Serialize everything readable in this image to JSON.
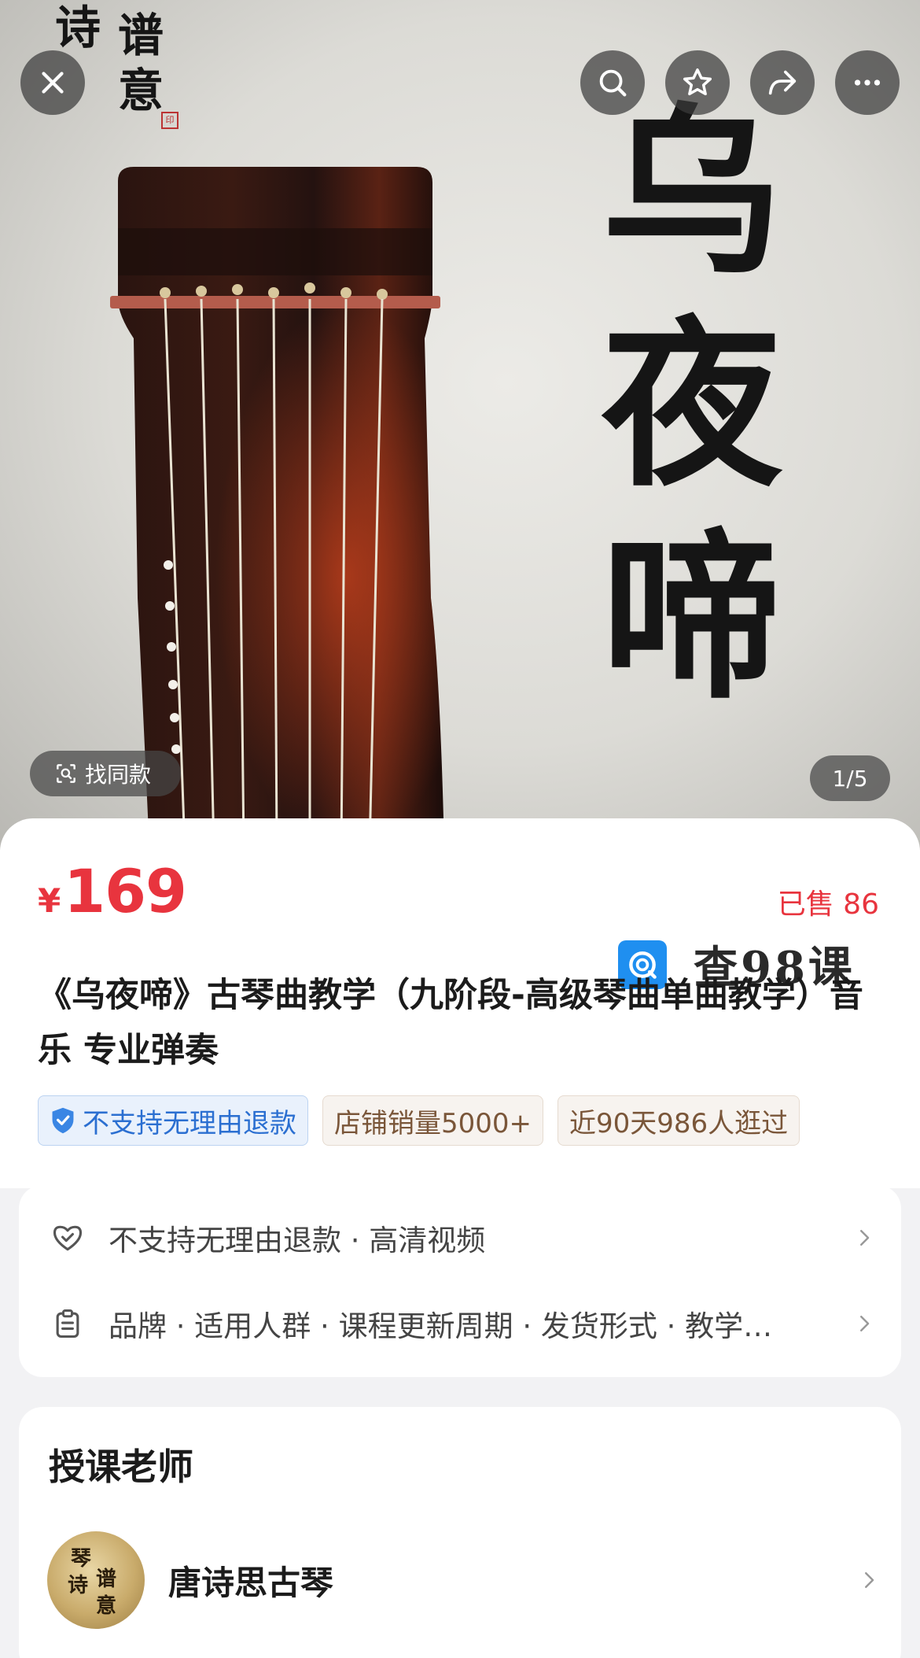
{
  "hero": {
    "calligraphy": [
      "乌",
      "夜",
      "啼"
    ],
    "logo_chars": [
      "诗",
      "谱",
      "意"
    ],
    "seal": "印",
    "image_counter": "1/5",
    "find_same_label": "找同款",
    "icons": {
      "close": "close-icon",
      "search": "search-icon",
      "favorite": "star-icon",
      "share": "share-icon",
      "more": "more-icon"
    }
  },
  "product": {
    "currency": "¥",
    "price": "169",
    "sold": "已售 86",
    "title": "《乌夜啼》古琴曲教学（九阶段-高级琴曲单曲教学）音乐 专业弹奏",
    "watermark": "查98课",
    "tags": [
      {
        "label": "不支持无理由退款",
        "style": "blue",
        "icon": "shield-check-icon"
      },
      {
        "label": "店铺销量5000+",
        "style": "tan"
      },
      {
        "label": "近90天986人逛过",
        "style": "tan"
      }
    ]
  },
  "services": {
    "row1": "不支持无理由退款 · 高清视频",
    "row2": "品牌 · 适用人群 · 课程更新周期 · 发货形式 · 教学…"
  },
  "teacher": {
    "heading": "授课老师",
    "name": "唐诗思古琴",
    "avatar_chars": [
      "琴",
      "诗",
      "谱",
      "意"
    ]
  },
  "colors": {
    "price_red": "#e8343e",
    "tag_blue": "#2b6fd1",
    "tag_tan": "#7a5639",
    "watermark_blue": "#1f8ff0"
  }
}
